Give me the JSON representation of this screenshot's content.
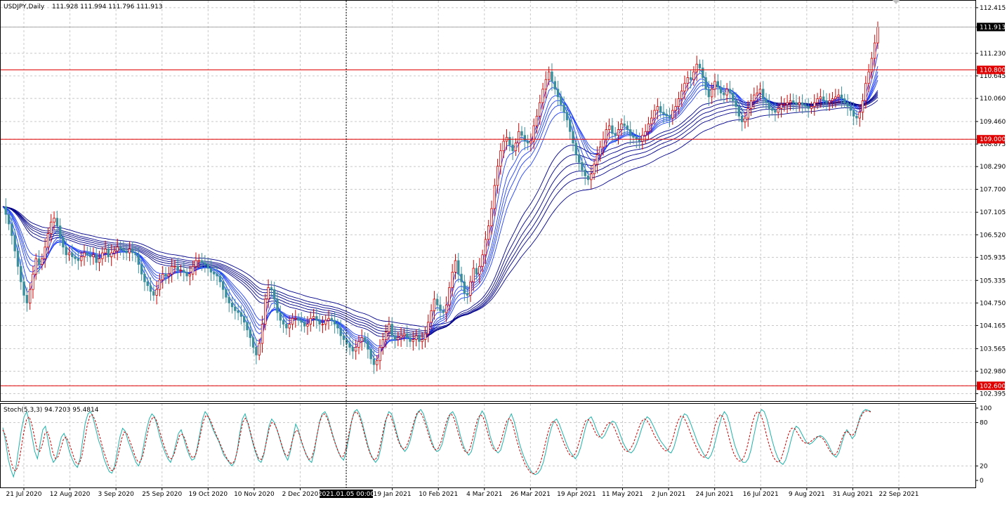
{
  "header": {
    "symbol_label": "USDJPY,Daily",
    "ohlc_label": "111.928 111.994 111.796 111.913"
  },
  "stoch_header": {
    "label": "Stoch(5,3,3) 94.7203 95.4814"
  },
  "colors": {
    "background": "#ffffff",
    "grid": "#c8c8c8",
    "bull_candle": "#d00000",
    "bear_candle": "#3a8f9a",
    "ribbon": "#00008b",
    "ribbon_fast": "#1f3fff",
    "level_line": "#e00000",
    "stoch_main": "#20b2aa",
    "stoch_signal": "#cc0000",
    "current_price_bg": "#000000"
  },
  "chart_data": [
    {
      "type": "line",
      "name": "price_pane",
      "x": [
        "21 Jul 2020",
        "12 Aug 2020",
        "3 Sep 2020",
        "25 Sep 2020",
        "19 Oct 2020",
        "10 Nov 2020",
        "2 Dec 2020",
        "2021.01.05 00:00",
        "19 Jan 2021",
        "10 Feb 2021",
        "4 Mar 2021",
        "26 Mar 2021",
        "19 Apr 2021",
        "11 May 2021",
        "2 Jun 2021",
        "24 Jun 2021",
        "16 Jul 2021",
        "9 Aug 2021",
        "31 Aug 2021",
        "22 Sep 2021"
      ],
      "y_ticks": [
        "112.415",
        "111.913",
        "111.230",
        "110.800",
        "110.645",
        "110.060",
        "109.460",
        "109.000",
        "108.875",
        "108.290",
        "107.700",
        "107.105",
        "106.520",
        "105.935",
        "105.335",
        "104.750",
        "104.165",
        "103.565",
        "102.980",
        "102.600",
        "102.395"
      ],
      "ylim": [
        102.35,
        112.45
      ],
      "grid": true,
      "horizontal_levels": [
        {
          "label": "110.800",
          "value": 110.8
        },
        {
          "label": "109.000",
          "value": 109.0
        },
        {
          "label": "102.600",
          "value": 102.6
        }
      ],
      "current_price": {
        "label": "111.913",
        "value": 111.913
      },
      "crosshair_x_label": "2021.01.05 00:00",
      "series": [
        {
          "values": [
            107.25,
            107.05,
            106.8,
            106.5,
            106.1,
            105.7,
            105.3,
            104.95,
            104.75,
            105.1,
            105.5,
            105.9,
            105.75,
            105.9,
            106.2,
            106.55,
            106.85,
            106.95,
            106.75,
            106.45,
            106.2,
            106.0,
            106.05,
            105.95,
            105.9,
            105.85,
            105.95,
            106.05,
            106.0,
            105.95,
            106.0,
            105.8,
            105.9,
            106.05,
            106.15,
            105.95,
            106.05,
            106.1,
            106.2,
            106.15,
            106.1,
            106.05,
            106.15,
            106.05,
            106.0,
            105.75,
            105.5,
            105.3,
            105.2,
            105.05,
            104.95,
            105.1,
            105.35,
            105.5,
            105.45,
            105.5,
            105.7,
            105.7,
            105.6,
            105.6,
            105.55,
            105.45,
            105.5,
            105.7,
            105.85,
            105.85,
            105.8,
            105.75,
            105.65,
            105.55,
            105.5,
            105.45,
            105.3,
            105.1,
            104.9,
            104.75,
            104.65,
            104.55,
            104.5,
            104.4,
            104.25,
            104.05,
            103.85,
            103.6,
            103.4,
            103.7,
            104.2,
            104.85,
            105.15,
            105.1,
            104.85,
            104.5,
            104.3,
            104.2,
            104.1,
            104.2,
            104.35,
            104.35,
            104.3,
            104.25,
            104.15,
            104.2,
            104.35,
            104.4,
            104.3,
            104.2,
            104.2,
            104.3,
            104.35,
            104.3,
            104.2,
            104.1,
            103.9,
            103.8,
            103.7,
            103.6,
            103.5,
            103.6,
            103.75,
            103.85,
            103.75,
            103.55,
            103.3,
            103.15,
            103.25,
            103.6,
            103.8,
            104.0,
            104.2,
            103.9,
            103.8,
            103.85,
            103.9,
            103.95,
            103.85,
            103.75,
            103.8,
            103.9,
            103.75,
            103.8,
            103.95,
            104.25,
            104.55,
            104.85,
            104.7,
            104.55,
            104.5,
            104.7,
            105.15,
            105.55,
            105.85,
            105.5,
            105.3,
            105.0,
            104.95,
            105.3,
            105.65,
            105.5,
            105.7,
            106.0,
            106.4,
            106.75,
            107.2,
            107.8,
            108.3,
            108.7,
            108.95,
            109.05,
            108.85,
            108.7,
            108.9,
            109.2,
            109.1,
            108.95,
            108.9,
            108.95,
            109.35,
            109.6,
            109.95,
            110.3,
            110.55,
            110.75,
            110.5,
            110.3,
            110.1,
            109.9,
            109.7,
            109.5,
            109.2,
            108.9,
            108.6,
            108.4,
            108.2,
            108.05,
            107.95,
            108.1,
            108.35,
            108.6,
            108.8,
            109.0,
            109.25,
            109.35,
            109.15,
            109.1,
            109.25,
            109.4,
            109.35,
            109.25,
            109.1,
            109.05,
            109.0,
            108.95,
            109.1,
            109.2,
            109.4,
            109.55,
            109.75,
            109.85,
            109.7,
            109.65,
            109.6,
            109.55,
            109.75,
            109.85,
            110.05,
            110.25,
            110.45,
            110.6,
            110.55,
            110.75,
            110.95,
            110.85,
            110.6,
            110.3,
            110.1,
            110.3,
            110.5,
            110.35,
            110.2,
            110.15,
            110.3,
            110.2,
            110.0,
            109.85,
            109.6,
            109.45,
            109.55,
            109.8,
            110.0,
            110.15,
            110.2,
            110.3,
            110.05,
            109.95,
            109.8,
            109.75,
            109.7,
            109.8,
            109.9,
            109.9,
            109.95,
            110.0,
            109.95,
            109.9,
            109.95,
            109.9,
            109.85,
            109.8,
            109.85,
            109.95,
            110.05,
            110.1,
            110.0,
            109.95,
            110.0,
            110.05,
            110.1,
            110.15,
            110.05,
            109.95,
            109.85,
            109.75,
            109.6,
            109.55,
            109.7,
            110.0,
            110.45,
            110.75,
            111.1,
            111.5,
            111.913
          ]
        }
      ]
    },
    {
      "type": "line",
      "name": "stochastic_pane",
      "y_ticks": [
        "100",
        "80",
        "20",
        "0"
      ],
      "ylim": [
        0,
        100
      ],
      "series": [
        {
          "name": "main",
          "values": [
            73,
            55,
            30,
            15,
            5,
            20,
            45,
            70,
            88,
            95,
            80,
            60,
            40,
            30,
            50,
            70,
            75,
            55,
            35,
            25,
            30,
            45,
            60,
            65,
            55,
            40,
            30,
            22,
            18,
            30,
            55,
            80,
            92,
            95,
            85,
            70,
            55,
            45,
            30,
            20,
            12,
            10,
            20,
            40,
            60,
            72,
            68,
            55,
            45,
            35,
            25,
            20,
            30,
            50,
            70,
            85,
            92,
            88,
            75,
            60,
            48,
            38,
            30,
            25,
            35,
            50,
            65,
            70,
            58,
            45,
            35,
            28,
            30,
            45,
            65,
            85,
            95,
            90,
            80,
            70,
            62,
            55,
            45,
            35,
            30,
            25,
            20,
            25,
            40,
            65,
            85,
            92,
            80,
            65,
            50,
            38,
            28,
            25,
            35,
            55,
            75,
            85,
            80,
            70,
            58,
            45,
            35,
            28,
            40,
            60,
            78,
            70,
            55,
            45,
            35,
            28,
            25,
            40,
            62,
            82,
            92,
            95,
            88,
            75,
            62,
            50,
            40,
            32,
            28,
            40,
            60,
            82,
            95,
            98,
            92,
            80,
            65,
            50,
            38,
            30,
            25,
            30,
            45,
            65,
            85,
            95,
            92,
            80,
            65,
            52,
            45,
            40,
            45,
            55,
            70,
            85,
            95,
            98,
            92,
            80,
            68,
            55,
            45,
            40,
            42,
            50,
            65,
            80,
            92,
            95,
            88,
            75,
            60,
            48,
            40,
            35,
            40,
            55,
            72,
            88,
            96,
            90,
            78,
            62,
            50,
            42,
            38,
            42,
            55,
            70,
            85,
            92,
            82,
            68,
            52,
            40,
            30,
            22,
            15,
            10,
            8,
            10,
            15,
            25,
            40,
            58,
            72,
            82,
            85,
            78,
            68,
            58,
            48,
            40,
            35,
            30,
            35,
            45,
            60,
            75,
            85,
            88,
            80,
            70,
            62,
            58,
            62,
            70,
            78,
            82,
            80,
            72,
            62,
            52,
            45,
            40,
            38,
            42,
            50,
            60,
            72,
            82,
            88,
            85,
            78,
            70,
            62,
            55,
            50,
            45,
            40,
            38,
            45,
            58,
            72,
            85,
            92,
            90,
            82,
            72,
            62,
            52,
            45,
            38,
            32,
            30,
            35,
            45,
            60,
            75,
            88,
            95,
            90,
            78,
            62,
            48,
            38,
            30,
            25,
            25,
            30,
            42,
            60,
            78,
            92,
            98,
            95,
            85,
            70,
            55,
            42,
            32,
            25,
            22,
            28,
            40,
            55,
            68,
            75,
            72,
            65,
            58,
            52,
            50,
            52,
            56,
            60,
            62,
            60,
            56,
            50,
            42,
            35,
            32,
            38,
            50,
            62,
            70,
            65,
            58,
            62,
            75,
            88,
            95,
            98,
            97,
            95.4
          ]
        },
        {
          "name": "signal",
          "values": [
            70,
            62,
            45,
            28,
            15,
            13,
            23,
            45,
            68,
            84,
            88,
            78,
            60,
            43,
            40,
            50,
            65,
            67,
            55,
            38,
            30,
            33,
            45,
            57,
            60,
            53,
            42,
            31,
            23,
            23,
            34,
            55,
            76,
            89,
            91,
            83,
            70,
            57,
            43,
            32,
            21,
            14,
            14,
            23,
            40,
            57,
            67,
            65,
            56,
            46,
            35,
            27,
            25,
            33,
            50,
            68,
            82,
            88,
            85,
            74,
            61,
            49,
            39,
            31,
            30,
            37,
            50,
            62,
            64,
            58,
            46,
            36,
            31,
            34,
            47,
            65,
            82,
            90,
            88,
            80,
            71,
            62,
            54,
            45,
            37,
            30,
            25,
            23,
            28,
            43,
            63,
            81,
            86,
            79,
            65,
            51,
            39,
            30,
            29,
            38,
            55,
            72,
            80,
            78,
            70,
            58,
            46,
            36,
            34,
            44,
            59,
            69,
            68,
            57,
            45,
            36,
            29,
            31,
            42,
            61,
            79,
            90,
            92,
            86,
            75,
            62,
            51,
            41,
            33,
            33,
            43,
            61,
            79,
            92,
            95,
            90,
            79,
            65,
            51,
            39,
            31,
            28,
            33,
            47,
            65,
            82,
            91,
            89,
            79,
            66,
            54,
            46,
            43,
            47,
            57,
            70,
            83,
            93,
            95,
            90,
            80,
            68,
            56,
            47,
            42,
            44,
            52,
            65,
            79,
            89,
            92,
            86,
            74,
            61,
            49,
            41,
            38,
            43,
            56,
            72,
            85,
            91,
            88,
            77,
            63,
            51,
            43,
            41,
            46,
            56,
            70,
            82,
            86,
            81,
            67,
            53,
            41,
            31,
            22,
            16,
            11,
            9,
            11,
            17,
            27,
            41,
            57,
            71,
            80,
            82,
            77,
            68,
            58,
            49,
            41,
            35,
            33,
            37,
            47,
            60,
            73,
            83,
            84,
            79,
            71,
            63,
            60,
            63,
            70,
            77,
            80,
            78,
            71,
            62,
            53,
            46,
            41,
            40,
            44,
            51,
            61,
            72,
            81,
            85,
            84,
            78,
            70,
            62,
            56,
            50,
            45,
            41,
            41,
            48,
            58,
            72,
            83,
            89,
            88,
            81,
            72,
            62,
            53,
            45,
            38,
            33,
            32,
            37,
            47,
            61,
            76,
            86,
            91,
            88,
            77,
            63,
            49,
            38,
            31,
            27,
            27,
            33,
            44,
            60,
            77,
            90,
            95,
            93,
            84,
            70,
            55,
            43,
            33,
            27,
            25,
            30,
            41,
            54,
            66,
            72,
            72,
            67,
            61,
            55,
            52,
            51,
            53,
            56,
            59,
            61,
            60,
            57,
            51,
            44,
            38,
            35,
            37,
            46,
            57,
            66,
            68,
            64,
            62,
            66,
            75,
            86,
            93,
            96,
            96,
            94.7
          ]
        }
      ]
    }
  ]
}
